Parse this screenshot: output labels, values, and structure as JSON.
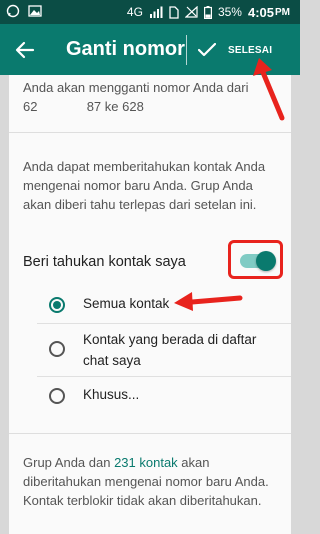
{
  "status_bar": {
    "network": "4G",
    "battery": "35%",
    "time": "4:05",
    "time_suffix": "PM"
  },
  "app_bar": {
    "title": "Ganti nomor",
    "done_label": "SELESAI"
  },
  "info": {
    "line1": "Anda akan mengganti nomor Anda dari",
    "line2_a": "628",
    "line2_b": "87 ke 628"
  },
  "description": "Anda dapat memberitahukan kontak Anda mengenai nomor baru Anda. Grup Anda akan diberi tahu terlepas dari setelan ini.",
  "notify": {
    "label": "Beri tahukan kontak saya",
    "enabled": true
  },
  "options": [
    {
      "label": "Semua kontak",
      "selected": true
    },
    {
      "label": "Kontak yang berada di daftar chat saya",
      "selected": false
    },
    {
      "label": "Khusus...",
      "selected": false
    }
  ],
  "footer": {
    "text_before": "Grup Anda dan ",
    "link": "231 kontak",
    "text_after": " akan diberitahukan mengenai nomor baru Anda. Kontak terblokir tidak akan diberitahukan."
  },
  "colors": {
    "header": "#0a7a6e",
    "status_bar": "#0b4d45",
    "accent": "#0a7a6e",
    "annotation": "#e8231d"
  }
}
